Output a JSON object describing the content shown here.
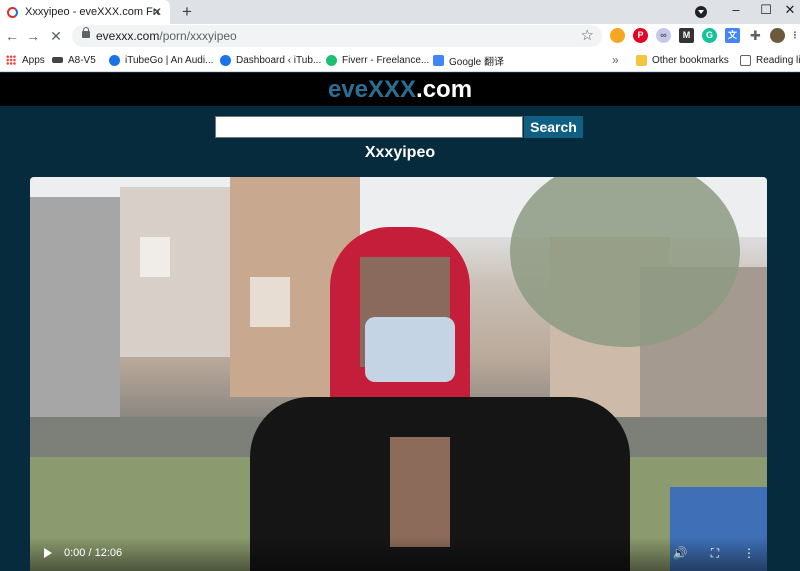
{
  "browser": {
    "tab": {
      "title": "Xxxyipeo - eveXXX.com Free P"
    },
    "address": {
      "host": "evexxx.com",
      "path": "/porn/xxxyipeo"
    },
    "bookmarks": [
      {
        "label": "Apps",
        "color": "#ea4335"
      },
      {
        "label": "A8-V5",
        "color": "#444444"
      },
      {
        "label": "iTubeGo | An Audi...",
        "color": "#1a73e8"
      },
      {
        "label": "Dashboard ‹ iTub...",
        "color": "#1a73e8"
      },
      {
        "label": "Fiverr - Freelance...",
        "color": "#1dbf73"
      },
      {
        "label": "Google 翻译",
        "color": "#4285f4"
      }
    ],
    "other_bookmarks": "Other bookmarks",
    "reading_list": "Reading lis"
  },
  "site": {
    "logo_part1": "eve",
    "logo_part2": "XXX",
    "logo_part3": ".com",
    "search_button": "Search",
    "search_value": "",
    "heading": "Xxxyipeo"
  },
  "player": {
    "time": "0:00 / 12:06"
  }
}
